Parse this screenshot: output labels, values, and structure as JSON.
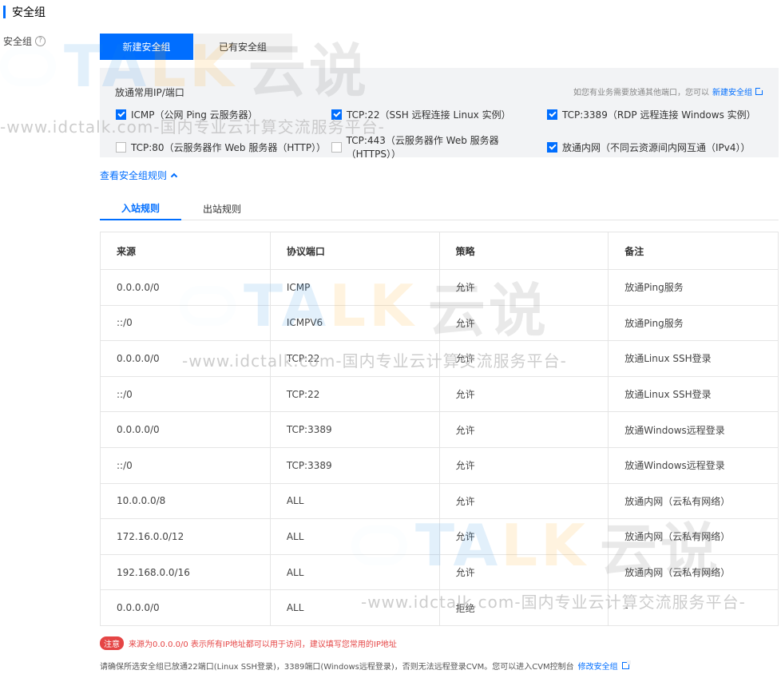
{
  "header": {
    "title": "安全组"
  },
  "left_label": {
    "text": "安全组",
    "help_glyph": "?"
  },
  "segment": {
    "active": "新建安全组",
    "inactive": "已有安全组"
  },
  "panel": {
    "title": "放通常用IP/端口",
    "tip_text": "如您有业务需要放通其他端口，您可以",
    "tip_link": "新建安全组",
    "checkboxes": [
      {
        "label": "ICMP（公网 Ping 云服务器）",
        "checked": true
      },
      {
        "label": "TCP:22（SSH 远程连接 Linux 实例）",
        "checked": true
      },
      {
        "label": "TCP:3389（RDP 远程连接 Windows 实例）",
        "checked": true
      },
      {
        "label": "TCP:80（云服务器作 Web 服务器（HTTP））",
        "checked": false
      },
      {
        "label": "TCP:443（云服务器作 Web 服务器（HTTPS））",
        "checked": false
      },
      {
        "label": "放通内网（不同云资源间内网互通（IPv4））",
        "checked": true
      }
    ]
  },
  "view_rules": "查看安全组规则",
  "tabs": [
    {
      "label": "入站规则"
    },
    {
      "label": "出站规则"
    }
  ],
  "table": {
    "headers": [
      "来源",
      "协议端口",
      "策略",
      "备注"
    ],
    "rows": [
      [
        "0.0.0.0/0",
        "ICMP",
        "允许",
        "放通Ping服务"
      ],
      [
        "::/0",
        "ICMPV6",
        "允许",
        "放通Ping服务"
      ],
      [
        "0.0.0.0/0",
        "TCP:22",
        "允许",
        "放通Linux SSH登录"
      ],
      [
        "::/0",
        "TCP:22",
        "允许",
        "放通Linux SSH登录"
      ],
      [
        "0.0.0.0/0",
        "TCP:3389",
        "允许",
        "放通Windows远程登录"
      ],
      [
        "::/0",
        "TCP:3389",
        "允许",
        "放通Windows远程登录"
      ],
      [
        "10.0.0.0/8",
        "ALL",
        "允许",
        "放通内网（云私有网络）"
      ],
      [
        "172.16.0.0/12",
        "ALL",
        "允许",
        "放通内网（云私有网络）"
      ],
      [
        "192.168.0.0/16",
        "ALL",
        "允许",
        "放通内网（云私有网络）"
      ],
      [
        "0.0.0.0/0",
        "ALL",
        "拒绝",
        "-"
      ]
    ]
  },
  "notice": {
    "badge": "注意",
    "text": "来源为0.0.0.0/0 表示所有IP地址都可以用于访问，建议填写您常用的IP地址"
  },
  "footnote": {
    "text": "请确保所选安全组已放通22端口(Linux SSH登录)，3389端口(Windows远程登录)，否则无法远程登录CVM。您可以进入CVM控制台",
    "link": "修改安全组"
  },
  "watermark": {
    "brand_part1": "TA",
    "brand_part2": "LK",
    "brand_cn": "云说",
    "site": "-www.idctalk.com-国内专业云计算交流服务平台-"
  },
  "colors": {
    "accent": "#006eff",
    "danger": "#e54545",
    "panel_bg": "#f2f3f5"
  }
}
